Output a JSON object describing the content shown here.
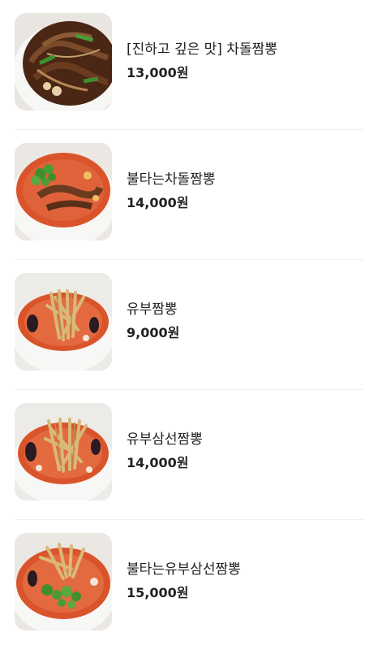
{
  "menu": {
    "items": [
      {
        "name": "[진하고 깊은 맛] 차돌짬뽕",
        "price": "13,000원",
        "image": "beef-jjamppong-dark-image"
      },
      {
        "name": "불타는차돌짬뽕",
        "price": "14,000원",
        "image": "spicy-beef-jjamppong-image"
      },
      {
        "name": "유부짬뽕",
        "price": "9,000원",
        "image": "tofu-jjamppong-image"
      },
      {
        "name": "유부삼선짬뽕",
        "price": "14,000원",
        "image": "tofu-seafood-jjamppong-image"
      },
      {
        "name": "불타는유부삼선짬뽕",
        "price": "15,000원",
        "image": "spicy-tofu-seafood-jjamppong-image"
      }
    ]
  },
  "colors": {
    "broth_dark": "#5a2f1a",
    "broth_red": "#d9542a",
    "tofu": "#d9b878",
    "scallion": "#3f8f2c",
    "bowl": "#f6f6f4"
  }
}
